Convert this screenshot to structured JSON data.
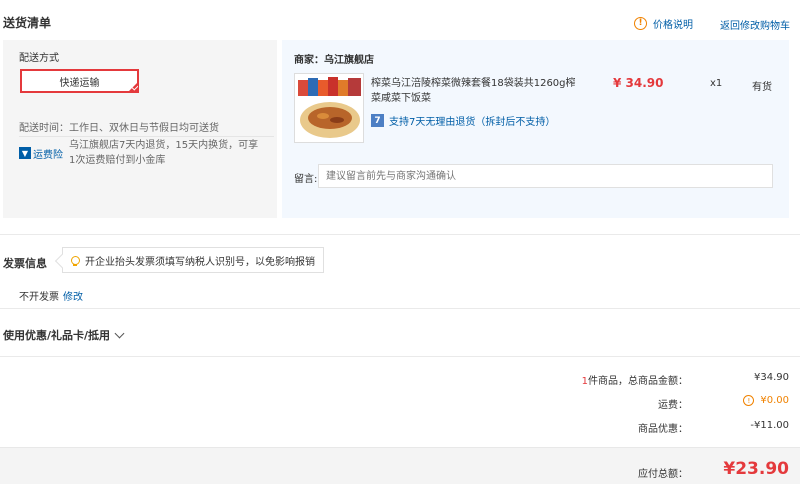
{
  "header": {
    "title": "送货清单",
    "price_explain": "价格说明",
    "back_to_cart": "返回修改购物车"
  },
  "delivery": {
    "method_label": "配送方式",
    "method_selected": "快递运输",
    "time_text": "配送时间：工作日、双休日与节假日均可送货",
    "insurance_label": "运费险",
    "insurance_text": "乌江旗舰店7天内退货，15天内换货，可享1次运费赔付到小金库"
  },
  "product": {
    "merchant": "商家：乌江旗舰店",
    "name": "榨菜乌江涪陵榨菜微辣套餐18袋装共1260g榨菜咸菜下饭菜",
    "price": "¥ 34.90",
    "qty": "x1",
    "stock": "有货",
    "return_badge": "7",
    "return_text": "支持7天无理由退货（拆封后不支持）",
    "message_label": "留言:",
    "message_placeholder": "建议留言前先与商家沟通确认"
  },
  "invoice": {
    "title": "发票信息",
    "tip": "开企业抬头发票须填写纳税人识别号，以免影响报销",
    "status": "不开发票",
    "edit": "修改"
  },
  "coupons": {
    "title": "使用优惠/礼品卡/抵用"
  },
  "summary": {
    "count": "1",
    "count_suffix": "件商品，总商品金额：",
    "goods_amount": "¥34.90",
    "shipping_label": "运费：",
    "shipping_amount": "¥0.00",
    "discount_label": "商品优惠：",
    "discount_amount": "-¥11.00",
    "total_label": "应付总额：",
    "total_amount": "¥23.90"
  },
  "colors": {
    "accent_red": "#e4393c",
    "link_blue": "#005ea7",
    "warn_orange": "#f08200"
  }
}
